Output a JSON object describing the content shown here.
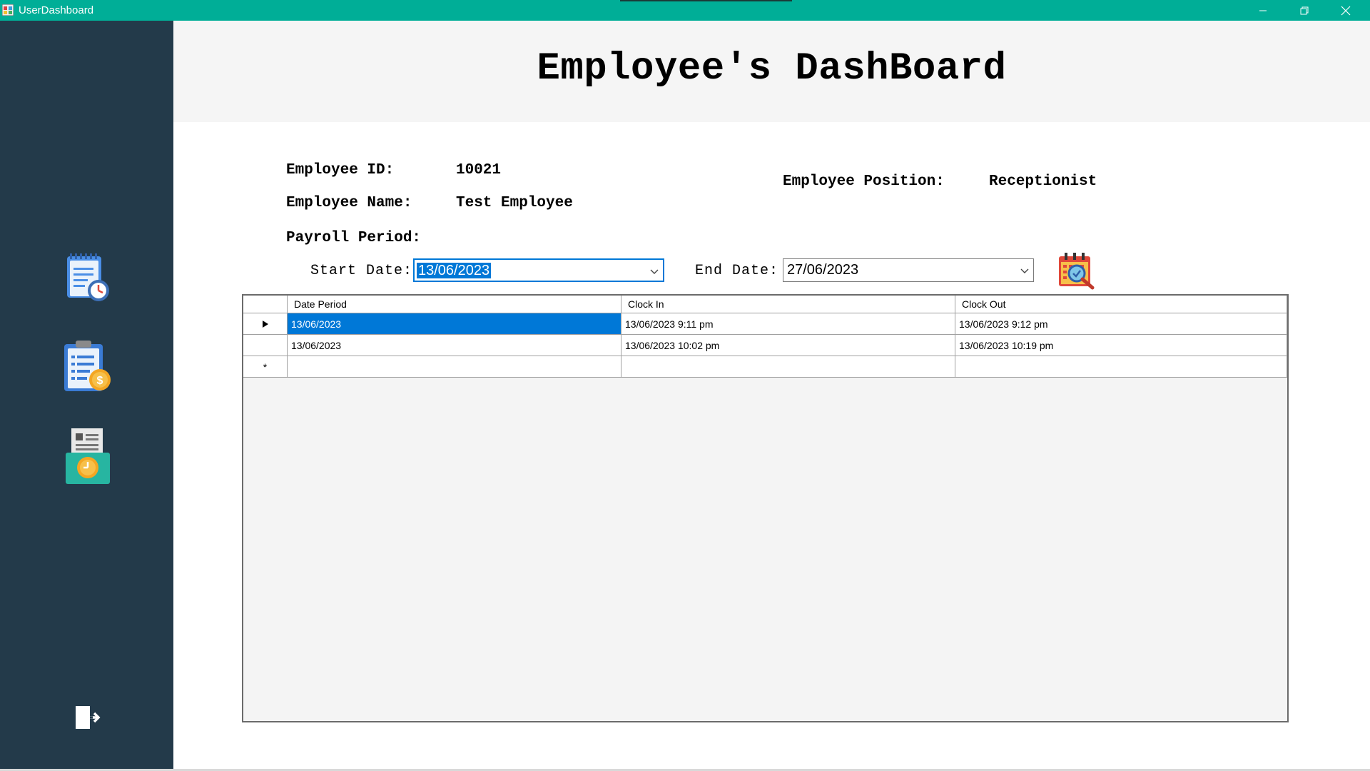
{
  "window": {
    "title": "UserDashboard",
    "controls": {
      "minimize": "minimize-icon",
      "restore": "restore-icon",
      "close": "close-icon"
    }
  },
  "colors": {
    "titlebar": "#00ae97",
    "sidebar": "#233a4a",
    "header_band": "#f5f5f5",
    "selection": "#0078d7"
  },
  "sidebar": {
    "items": [
      {
        "icon": "timesheet-clock-icon"
      },
      {
        "icon": "payroll-clipboard-icon"
      },
      {
        "icon": "time-clock-card-icon"
      }
    ],
    "logout_icon": "logout-icon"
  },
  "header": {
    "title": "Employee's DashBoard"
  },
  "employee": {
    "id_label": "Employee ID:",
    "id_value": "10021",
    "name_label": "Employee Name:",
    "name_value": "Test Employee",
    "position_label": "Employee Position:",
    "position_value": "Receptionist"
  },
  "payroll": {
    "period_label": "Payroll Period:",
    "start_label": "Start Date:",
    "start_value": "13/06/2023",
    "end_label": "End Date:",
    "end_value": "27/06/2023",
    "search_icon": "calendar-search-icon"
  },
  "grid": {
    "columns": [
      "Date Period",
      "Clock In",
      "Clock Out"
    ],
    "rows": [
      {
        "marker": "▶",
        "date_period": "13/06/2023",
        "clock_in": "13/06/2023 9:11 pm",
        "clock_out": "13/06/2023 9:12 pm"
      },
      {
        "marker": "",
        "date_period": "13/06/2023",
        "clock_in": "13/06/2023 10:02 pm",
        "clock_out": "13/06/2023 10:19 pm"
      }
    ],
    "new_row_marker": "*"
  }
}
